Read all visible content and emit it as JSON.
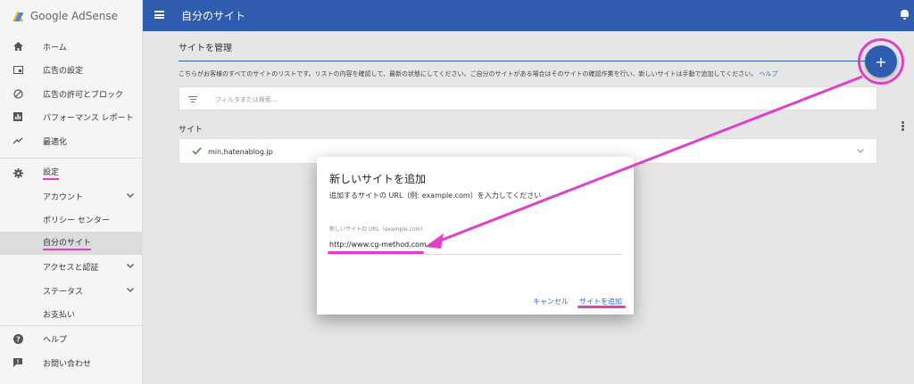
{
  "app": {
    "name": "Google AdSense"
  },
  "topbar": {
    "title": "自分のサイト"
  },
  "sidebar": {
    "items": [
      {
        "label": "ホーム",
        "icon": "home-icon"
      },
      {
        "label": "広告の設定",
        "icon": "ad-settings-icon"
      },
      {
        "label": "広告の許可とブロック",
        "icon": "block-icon"
      },
      {
        "label": "パフォーマンス レポート",
        "icon": "bar-chart-icon"
      },
      {
        "label": "最適化",
        "icon": "trending-icon"
      },
      {
        "label": "設定",
        "icon": "gear-icon"
      },
      {
        "label": "アカウント",
        "icon": ""
      },
      {
        "label": "ポリシー センター",
        "icon": ""
      },
      {
        "label": "自分のサイト",
        "icon": ""
      },
      {
        "label": "アクセスと認証",
        "icon": ""
      },
      {
        "label": "ステータス",
        "icon": ""
      },
      {
        "label": "お支払い",
        "icon": ""
      },
      {
        "label": "ヘルプ",
        "icon": "help-icon"
      },
      {
        "label": "お問い合わせ",
        "icon": "feedback-icon"
      }
    ]
  },
  "main": {
    "section_title": "サイトを管理",
    "description": "こちらがお客様のすべてのサイトのリストです。リストの内容を確認して、最新の状態にしてください。ご自分のサイトがある場合はそのサイトの確認作業を行い、新しいサイトは手動で追加してください。",
    "help_link": "ヘルプ",
    "filter_placeholder": "フィルタまたは検索...",
    "sites_label": "サイト",
    "sites": [
      {
        "domain": "min.hatenablog.jp",
        "status": "verified"
      }
    ],
    "fab_label": "+"
  },
  "dialog": {
    "title": "新しいサイトを追加",
    "subtitle": "追加するサイトの URL（例: example.com）を入力してください",
    "field_label": "新しいサイトの URL（example.com）",
    "field_value": "http://www.cg-method.com",
    "cancel_label": "キャンセル",
    "add_label": "サイトを追加"
  },
  "colors": {
    "topbar": "#2f5cae",
    "annotation": "#e040c8",
    "link": "#2f6fd6"
  }
}
